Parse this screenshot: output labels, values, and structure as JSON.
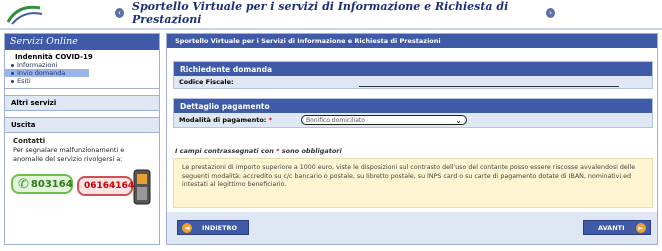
{
  "header": {
    "title": "Sportello Virtuale per i servizi di Informazione e Richiesta di Prestazioni"
  },
  "sidebar": {
    "title": "Servizi Online",
    "section1": "Indennità COVID-19",
    "items": [
      {
        "label": "Informazioni"
      },
      {
        "label": "Invio domanda"
      },
      {
        "label": "Esiti"
      }
    ],
    "other": "Altri servizi",
    "exit": "Uscita",
    "contacts_title": "Contatti",
    "contacts_text": "Per segnalare malfunzionamenti e anomalie del servizio rivolgersi a:",
    "phone1": "803164",
    "phone2": "06164164"
  },
  "main": {
    "title": "Sportello Virtuale per i Servizi di Informazione e Richiesta di Prestazioni",
    "requester": {
      "title": "Richiedente domanda",
      "fiscal_label": "Codice Fiscale:",
      "fiscal_value": ""
    },
    "payment": {
      "title": "Dettaglio pagamento",
      "mode_label": "Modalità di pagamento:",
      "mode_value": "Bonifico domiciliato"
    },
    "required_note": "I campi contrassegnati con",
    "required_star": "*",
    "required_note2": "sono obbligatori",
    "info": "Le prestazioni di importo superiore a 1000 euro, viste le disposizioni sul contrasto dell'uso del contante posso essere riscosse avvalendosi delle seguenti modalità: accredito su c/c bancario o postale, su libretto postale, su INPS card o su carte di pagamento dotate di IBAN, nominativi ed intestati al legittimo beneficiario.",
    "back_label": "INDIETRO",
    "next_label": "AVANTI"
  }
}
